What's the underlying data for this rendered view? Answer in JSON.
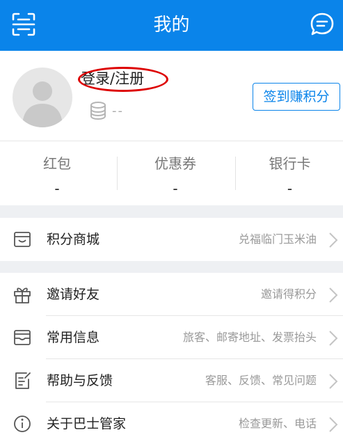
{
  "header": {
    "title": "我的",
    "left_icon": "scan-icon",
    "right_icon": "message-icon"
  },
  "profile": {
    "login_text": "登录/注册",
    "coins_value": "--",
    "checkin_label": "签到赚积分"
  },
  "stats": [
    {
      "label": "红包",
      "value": "-"
    },
    {
      "label": "优惠券",
      "value": "-"
    },
    {
      "label": "银行卡",
      "value": "-"
    }
  ],
  "menu": [
    {
      "label": "积分商城",
      "hint": "兑福临门玉米油",
      "icon": "store-icon"
    },
    {
      "label": "邀请好友",
      "hint": "邀请得积分",
      "icon": "gift-icon"
    },
    {
      "label": "常用信息",
      "hint": "旅客、邮寄地址、发票抬头",
      "icon": "inbox-icon"
    },
    {
      "label": "帮助与反馈",
      "hint": "客服、反馈、常见问题",
      "icon": "feedback-icon"
    },
    {
      "label": "关于巴士管家",
      "hint": "检查更新、电话",
      "icon": "info-icon"
    }
  ],
  "colors": {
    "brand": "#0a84ea",
    "annotation_ring": "#dd0000"
  }
}
